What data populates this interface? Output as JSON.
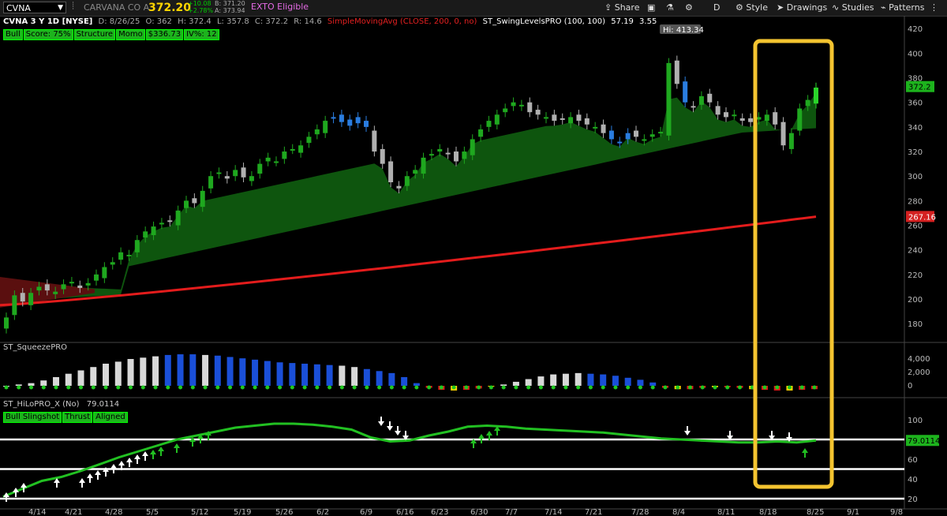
{
  "toolbar": {
    "symbol": "CVNA",
    "company": "CARVANA CO A",
    "price": "372.20",
    "change": "+10.08",
    "change_pct": "+2.78%",
    "bid": "B: 371.20",
    "ask": "A: 373.94",
    "exto": "EXTO Eligible",
    "share": "Share",
    "period": "D",
    "style": "Style",
    "drawings": "Drawings",
    "studies": "Studies",
    "patterns": "Patterns"
  },
  "header": {
    "title": "CVNA 3 Y 1D [NYSE]",
    "date": "D: 8/26/25",
    "open": "O: 362",
    "high": "H: 372.4",
    "low": "L: 357.8",
    "close": "C: 372.2",
    "range": "R: 14.6",
    "sma": "SimpleMovingAvg (CLOSE, 200, 0, no)",
    "swing": "ST_SwingLevelsPRO (100, 100)",
    "swing_v1": "57.19",
    "swing_v2": "3.55"
  },
  "badges": [
    "Bull",
    "Score: 75%",
    "Structure",
    "Momo",
    "$336.73",
    "IV%: 12"
  ],
  "squeeze_title": "ST_SqueezePRO",
  "hilo_title": "ST_HiLoPRO_X (No)",
  "hilo_value": "79.0114",
  "hilo_badges": [
    "Bull Slingshot",
    "Thrust",
    "Aligned"
  ],
  "chart_data": {
    "type": "candlestick",
    "x_ticks": [
      "4/14",
      "4/21",
      "4/28",
      "5/5",
      "5/12",
      "5/19",
      "5/26",
      "6/2",
      "6/9",
      "6/16",
      "6/23",
      "6/30",
      "7/7",
      "7/14",
      "7/21",
      "7/28",
      "8/4",
      "8/11",
      "8/18",
      "8/25",
      "9/1",
      "9/8"
    ],
    "price_axis": [
      420,
      400,
      380,
      360,
      340,
      320,
      300,
      280,
      260,
      240,
      220,
      200,
      180
    ],
    "price_ylim": [
      166,
      424
    ],
    "last_price": "372.2",
    "sma_value": "267.16",
    "high_label": "Hi: 413.34",
    "squeeze_axis": [
      "4,000",
      "2,000",
      "0"
    ],
    "hilo_axis": [
      100,
      80,
      60,
      40,
      20
    ],
    "hilo_lines": [
      80,
      50,
      20
    ],
    "closes": [
      185,
      203,
      198,
      205,
      210,
      207,
      206,
      212,
      214,
      209,
      213,
      220,
      226,
      230,
      238,
      236,
      248,
      255,
      259,
      262,
      263,
      272,
      280,
      278,
      288,
      300,
      303,
      298,
      305,
      299,
      300,
      310,
      315,
      312,
      320,
      322,
      325,
      332,
      338,
      345,
      348,
      344,
      346,
      343,
      340,
      320,
      310,
      295,
      290,
      300,
      305,
      315,
      318,
      322,
      318,
      312,
      320,
      330,
      338,
      345,
      350,
      355,
      360,
      358,
      352,
      350,
      348,
      345,
      346,
      348,
      345,
      342,
      340,
      335,
      330,
      328,
      335,
      332,
      330,
      334,
      336,
      392,
      375,
      360,
      356,
      365,
      360,
      350,
      348,
      350,
      345,
      344,
      348,
      350,
      342,
      325,
      335,
      355,
      362,
      372
    ],
    "sma200": [
      195,
      267
    ],
    "hilo_series": [
      22,
      30,
      38,
      42,
      48,
      55,
      62,
      68,
      74,
      80,
      84,
      88,
      92,
      94,
      96,
      96,
      95,
      93,
      90,
      82,
      78,
      79,
      84,
      88,
      93,
      94,
      93,
      91,
      90,
      89,
      88,
      87,
      85,
      83,
      81,
      80,
      79,
      78,
      77,
      77,
      78,
      77,
      79
    ],
    "squeeze_bars": [
      0,
      0.2,
      0.4,
      0.8,
      1.3,
      1.8,
      2.3,
      2.8,
      3.3,
      3.6,
      4.0,
      4.2,
      4.4,
      4.6,
      4.7,
      4.7,
      4.6,
      4.5,
      4.3,
      4.1,
      3.9,
      3.7,
      3.5,
      3.4,
      3.3,
      3.2,
      3.1,
      3.0,
      2.8,
      2.5,
      2.2,
      1.9,
      1.3,
      0.4,
      -0.3,
      -0.6,
      -0.7,
      -0.6,
      -0.4,
      -0.1,
      0.2,
      0.6,
      1.0,
      1.4,
      1.7,
      1.8,
      1.9,
      1.8,
      1.7,
      1.5,
      1.2,
      0.9,
      0.5,
      -0.3,
      -0.5,
      -0.5,
      -0.3,
      -0.2,
      -0.2,
      -0.3,
      -0.5,
      -0.6,
      -0.7,
      -0.7,
      -0.6,
      -0.5
    ]
  }
}
